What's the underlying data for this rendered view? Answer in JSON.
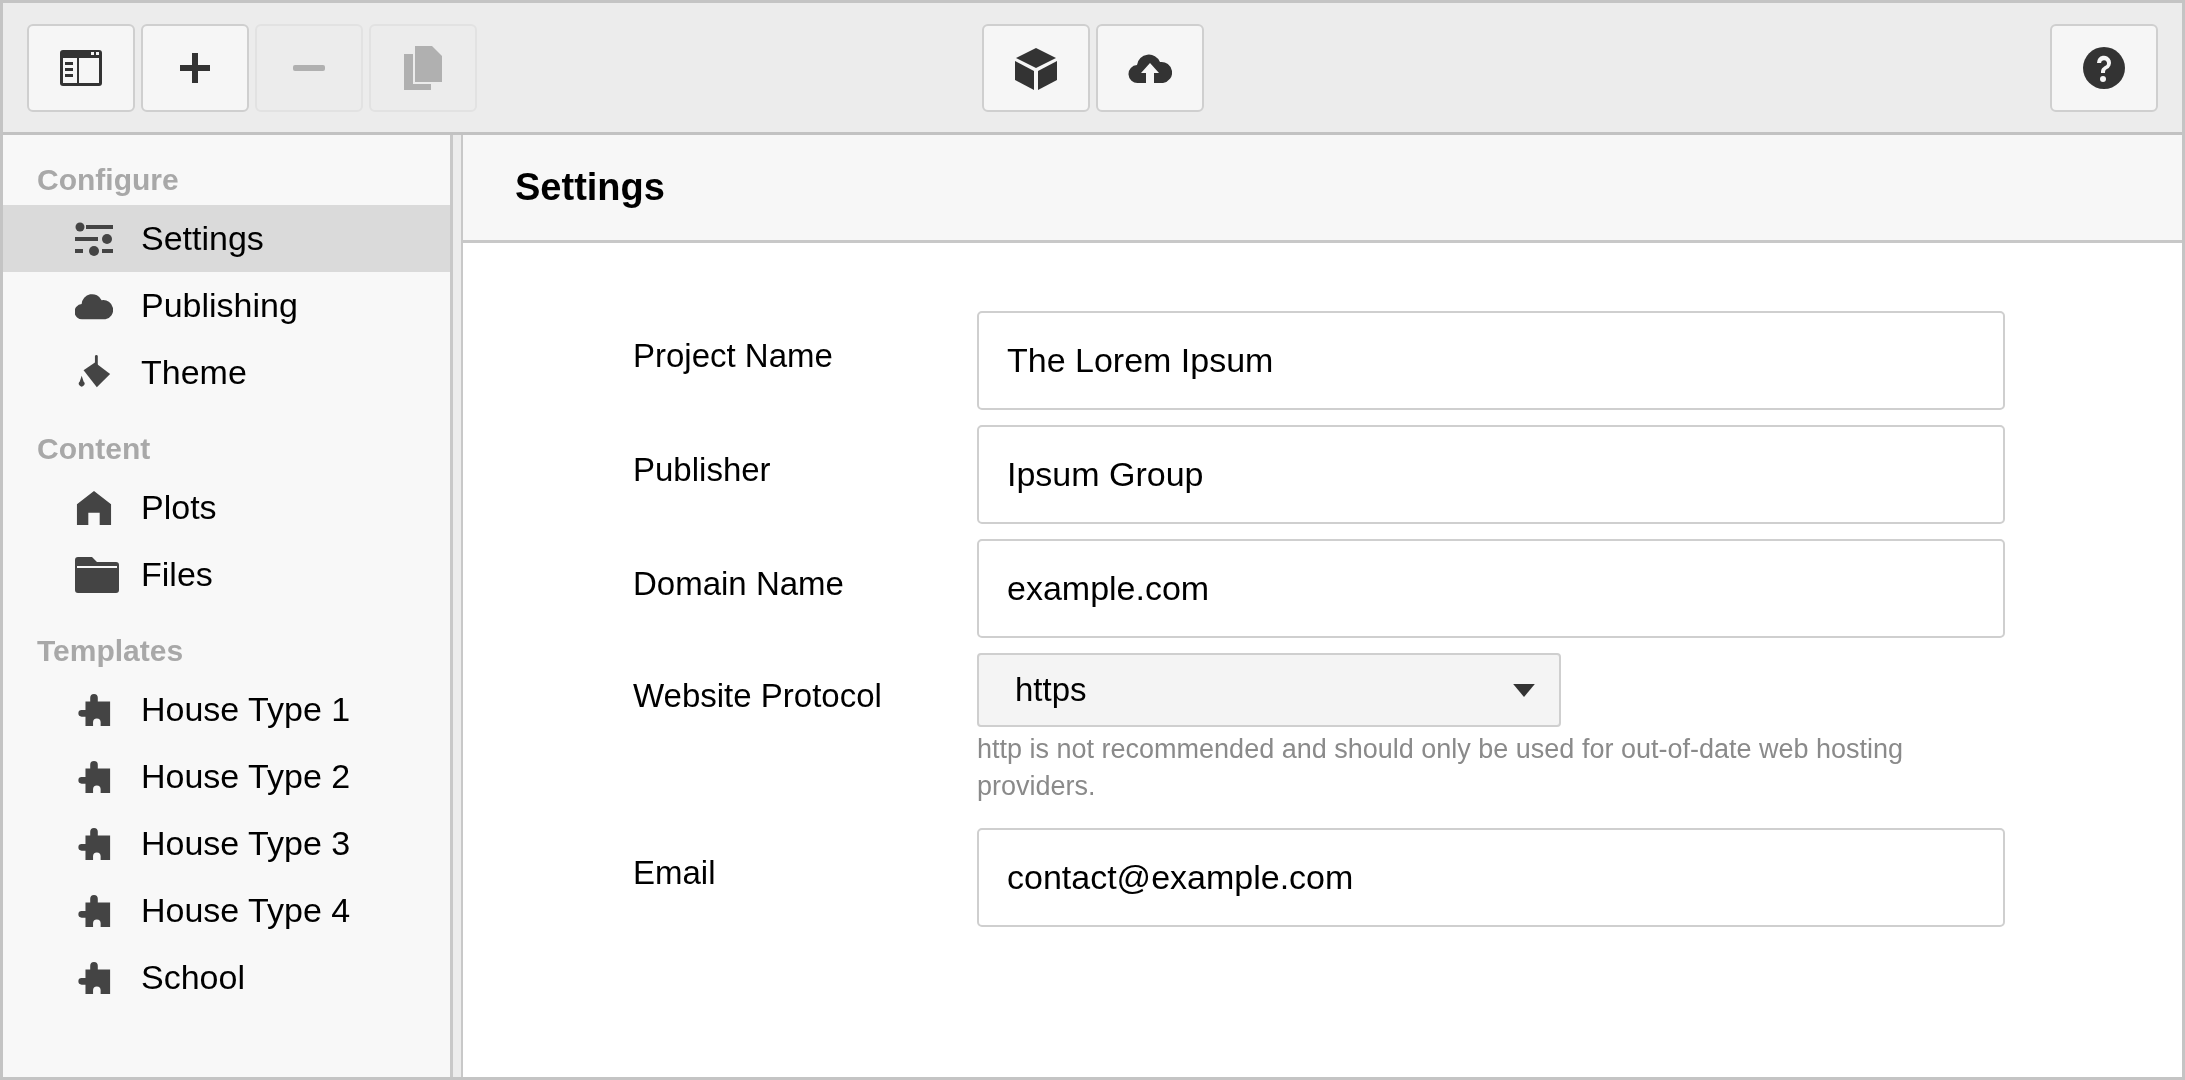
{
  "toolbar": {
    "left": [
      {
        "kind": "sidebar-toggle",
        "disabled": false
      },
      {
        "kind": "add",
        "disabled": false
      },
      {
        "kind": "remove",
        "disabled": true
      },
      {
        "kind": "copy",
        "disabled": true
      }
    ],
    "center": [
      {
        "kind": "package",
        "disabled": false
      },
      {
        "kind": "upload",
        "disabled": false
      }
    ],
    "right": [
      {
        "kind": "help",
        "disabled": false
      }
    ]
  },
  "sidebar": {
    "groups": [
      {
        "title": "Configure",
        "items": [
          {
            "label": "Settings",
            "kind": "sliders",
            "selected": true
          },
          {
            "label": "Publishing",
            "kind": "cloud",
            "selected": false
          },
          {
            "label": "Theme",
            "kind": "paint",
            "selected": false
          }
        ]
      },
      {
        "title": "Content",
        "items": [
          {
            "label": "Plots",
            "kind": "house",
            "selected": false
          },
          {
            "label": "Files",
            "kind": "folder",
            "selected": false
          }
        ]
      },
      {
        "title": "Templates",
        "items": [
          {
            "label": "House Type 1",
            "kind": "puzzle",
            "selected": false
          },
          {
            "label": "House Type 2",
            "kind": "puzzle",
            "selected": false
          },
          {
            "label": "House Type 3",
            "kind": "puzzle",
            "selected": false
          },
          {
            "label": "House Type 4",
            "kind": "puzzle",
            "selected": false
          },
          {
            "label": "School",
            "kind": "puzzle",
            "selected": false
          }
        ]
      }
    ]
  },
  "panel": {
    "title": "Settings",
    "fields": [
      {
        "label": "Project Name",
        "kind": "text",
        "value": "The Lorem Ipsum"
      },
      {
        "label": "Publisher",
        "kind": "text",
        "value": "Ipsum Group"
      },
      {
        "label": "Domain Name",
        "kind": "text",
        "value": "example.com"
      },
      {
        "label": "Website Protocol",
        "kind": "select",
        "value": "https",
        "hint": "http is not recommended and should only be used for out-of-date web hosting providers."
      },
      {
        "label": "Email",
        "kind": "text",
        "value": "contact@example.com"
      }
    ]
  }
}
